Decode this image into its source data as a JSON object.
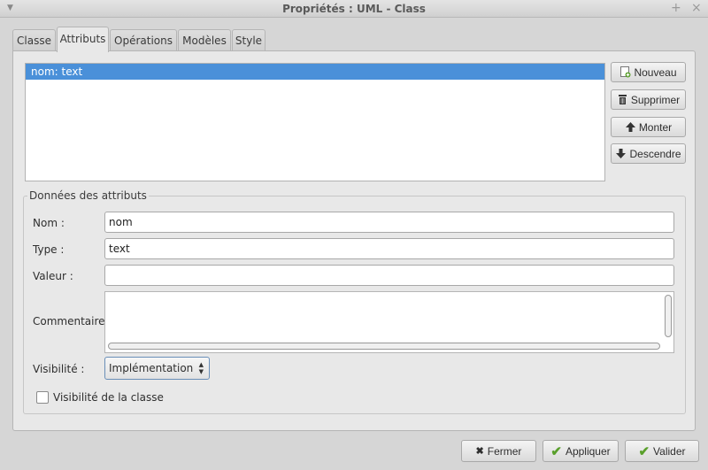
{
  "window": {
    "title": "Propriétés : UML - Class",
    "controls": [
      "+",
      "×"
    ]
  },
  "tabs": [
    {
      "label": "Classe",
      "active": false
    },
    {
      "label": "Attributs",
      "active": true
    },
    {
      "label": "Opérations",
      "active": false
    },
    {
      "label": "Modèles",
      "active": false
    },
    {
      "label": "Style",
      "active": false
    }
  ],
  "attributes": {
    "list": [
      {
        "label": "nom: text",
        "selected": true
      }
    ],
    "buttons": {
      "new": "Nouveau",
      "delete": "Supprimer",
      "up": "Monter",
      "down": "Descendre"
    }
  },
  "attribute_data": {
    "legend": "Données des attributs",
    "name_label": "Nom :",
    "name_value": "nom",
    "type_label": "Type :",
    "type_value": "text",
    "value_label": "Valeur :",
    "value_value": "",
    "comment_label": "Commentaire :",
    "comment_value": "",
    "visibility_label": "Visibilité :",
    "visibility_value": "Implémentation",
    "class_scope_label": "Visibilité de la classe",
    "class_scope_checked": false
  },
  "footer": {
    "close": "Fermer",
    "apply": "Appliquer",
    "ok": "Valider"
  },
  "colors": {
    "selection": "#4a90d9",
    "check_green": "#5aa02c",
    "focus_border": "#6a8fb8"
  }
}
